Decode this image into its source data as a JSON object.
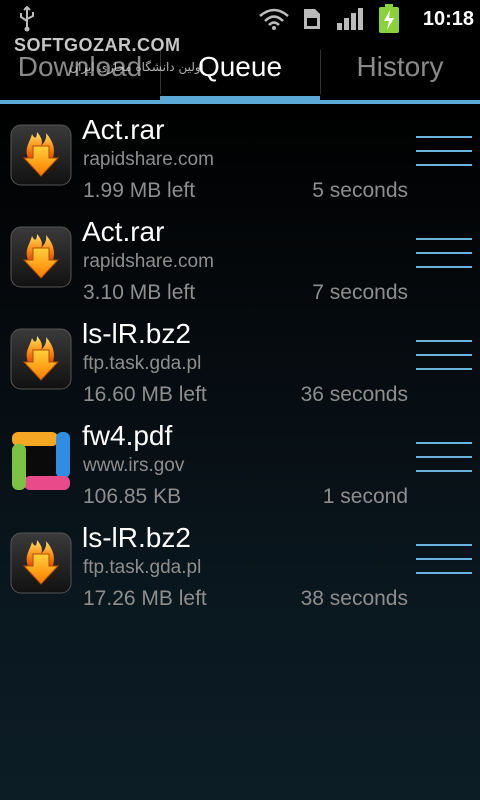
{
  "status_bar": {
    "time": "10:18",
    "icons": [
      "usb-icon",
      "wifi-icon",
      "sim-icon",
      "signal-icon",
      "battery-charging-icon"
    ]
  },
  "watermark": {
    "text": "SOFTGOZAR.COM",
    "subtext": "اولین دانشگاه مجازی ایران"
  },
  "tabs": [
    {
      "label": "Download",
      "active": false
    },
    {
      "label": "Queue",
      "active": true
    },
    {
      "label": "History",
      "active": false
    }
  ],
  "colors": {
    "accent": "#5aa9d6",
    "secondary_text": "#8e8e8e"
  },
  "queue": [
    {
      "name": "Act.rar",
      "host": "rapidshare.com",
      "size": "1.99 MB left",
      "eta": "5 seconds",
      "icon": "download-fire-icon"
    },
    {
      "name": "Act.rar",
      "host": "rapidshare.com",
      "size": "3.10 MB left",
      "eta": "7 seconds",
      "icon": "download-fire-icon"
    },
    {
      "name": "ls-lR.bz2",
      "host": "ftp.task.gda.pl",
      "size": "16.60 MB left",
      "eta": "36 seconds",
      "icon": "download-fire-icon"
    },
    {
      "name": "fw4.pdf",
      "host": "www.irs.gov",
      "size": "106.85 KB",
      "eta": "1 second",
      "icon": "colorful-square-icon"
    },
    {
      "name": "ls-lR.bz2",
      "host": "ftp.task.gda.pl",
      "size": "17.26 MB left",
      "eta": "38 seconds",
      "icon": "download-fire-icon"
    }
  ]
}
